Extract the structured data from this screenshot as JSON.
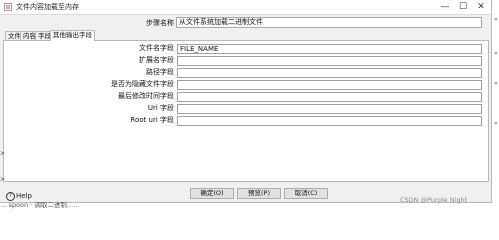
{
  "window": {
    "title": "文件内容加载至内存",
    "controls": {
      "minimize": "—",
      "maximize": "☐",
      "close": "✕"
    }
  },
  "step": {
    "label": "步骤名称",
    "value": "从文件系统加载二进制文件"
  },
  "tabs": [
    {
      "label": "文件",
      "active": false
    },
    {
      "label": "内容",
      "active": false
    },
    {
      "label": "字段",
      "active": false
    },
    {
      "label": "其他输出字段",
      "active": true
    }
  ],
  "fields": [
    {
      "label": "文件名字段",
      "value": "FILE_NAME"
    },
    {
      "label": "扩展名字段",
      "value": ""
    },
    {
      "label": "路径字段",
      "value": ""
    },
    {
      "label": "是否为隐藏文件字段",
      "value": ""
    },
    {
      "label": "最后修改时间字段",
      "value": ""
    },
    {
      "label": "Uri 字段",
      "value": ""
    },
    {
      "label": "Root uri 字段",
      "value": ""
    }
  ],
  "buttons": {
    "ok": "确定(O)",
    "preview": "预览(P)",
    "cancel": "取消(C)"
  },
  "help": {
    "label": "Help"
  },
  "watermark": "CSDN @Purple Night",
  "background": {
    "partial_text": "… spoon · 调取二进制……"
  }
}
